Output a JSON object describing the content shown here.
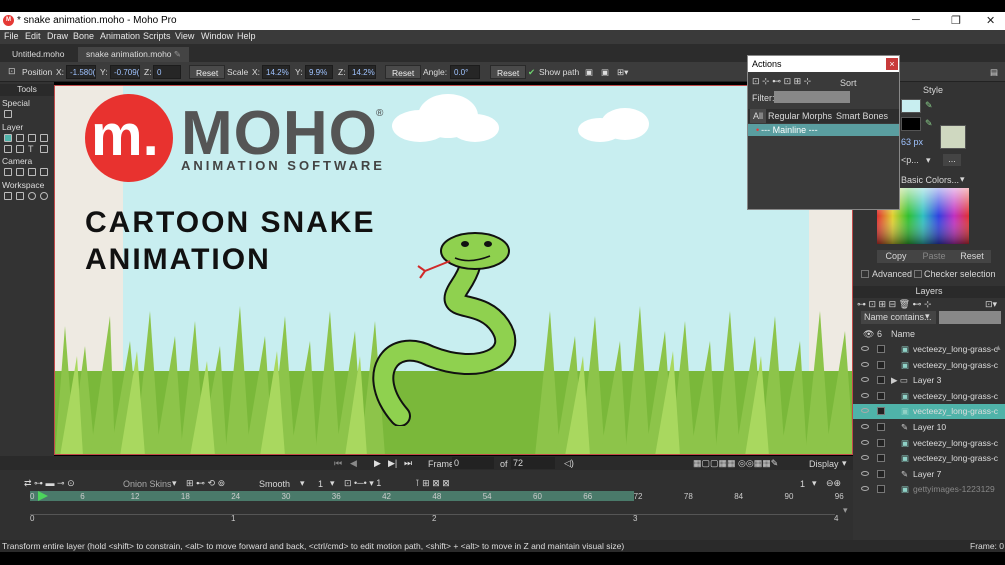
{
  "window": {
    "title": "* snake animation.moho - Moho Pro",
    "app_icon": "moho-app-icon"
  },
  "menu": [
    "File",
    "Edit",
    "Draw",
    "Bone",
    "Animation",
    "Scripts",
    "View",
    "Window",
    "Help"
  ],
  "tabs": [
    {
      "label": "Untitled.moho"
    },
    {
      "label": "snake animation.moho"
    }
  ],
  "tool_options": {
    "position_label": "Position",
    "x_label": "X:",
    "x_val": "-1.580(",
    "y_label": "Y:",
    "y_val": "-0.709(",
    "z_label": "Z:",
    "z_val": "0",
    "reset1": "Reset",
    "scale_label": "Scale",
    "sx_label": "X:",
    "sx_val": "14.2%",
    "sy_label": "Y:",
    "sy_val": "9.9%",
    "sz_label": "Z:",
    "sz_val": "14.2%",
    "reset2": "Reset",
    "angle_label": "Angle:",
    "angle_val": "0.0°",
    "reset3": "Reset",
    "show_path": "Show path"
  },
  "tools_panel": {
    "title": "Tools",
    "sections": [
      "Special",
      "Layer",
      "Camera",
      "Workspace"
    ]
  },
  "canvas": {
    "logo_letter": "m.",
    "logo_text": "MOHO",
    "logo_tm": "®",
    "logo_sub": "ANIMATION SOFTWARE",
    "headline1": "CARTOON SNAKE",
    "headline2": "ANIMATION"
  },
  "playbar": {
    "frame_label": "Frame",
    "frame_val": "0",
    "of_label": "of",
    "of_val": "72",
    "display_label": "Display"
  },
  "timeline": {
    "onion_label": "Onion Skins",
    "smooth_label": "Smooth",
    "smooth_val": "1",
    "kf_val": "1",
    "right_val": "1",
    "ticks": [
      "0",
      "6",
      "12",
      "18",
      "24",
      "30",
      "36",
      "42",
      "48",
      "54",
      "60",
      "66",
      "72",
      "78",
      "84",
      "90",
      "96"
    ],
    "sub_ticks": [
      "0",
      "1",
      "2",
      "3",
      "4"
    ]
  },
  "status": {
    "text": "Transform entire layer (hold <shift> to constrain, <alt> to move forward and back, <ctrl/cmd> to edit motion path, <shift> + <alt> to move in Z and maintain visual size)",
    "frame": "Frame: 0"
  },
  "style_panel": {
    "title": "Style",
    "px_val": "63 px",
    "p_val": "<p...",
    "palette_label": "Basic Colors...",
    "copy": "Copy",
    "paste": "Paste",
    "reset": "Reset",
    "advanced": "Advanced",
    "checker": "Checker selection",
    "fill_color": "#c8eef0",
    "stroke_color": "#000000"
  },
  "actions_panel": {
    "title": "Actions",
    "sort": "Sort",
    "filter_label": "Filter:",
    "tabs": [
      "All",
      "Regular",
      "Morphs",
      "Smart Bones"
    ],
    "mainline": "--- Mainline ---"
  },
  "layers_panel": {
    "title": "Layers",
    "filter_label": "Name contains...",
    "name_header": "Name",
    "layers": [
      {
        "name": "vecteezy_long-grass-c",
        "type": "image"
      },
      {
        "name": "vecteezy_long-grass-c",
        "type": "image"
      },
      {
        "name": "Layer 3",
        "type": "group"
      },
      {
        "name": "vecteezy_long-grass-c",
        "type": "image"
      },
      {
        "name": "vecteezy_long-grass-c",
        "type": "image",
        "selected": true
      },
      {
        "name": "Layer 10",
        "type": "vector"
      },
      {
        "name": "vecteezy_long-grass-c",
        "type": "image"
      },
      {
        "name": "vecteezy_long-grass-c",
        "type": "image"
      },
      {
        "name": "Layer 7",
        "type": "vector"
      },
      {
        "name": "gettyimages-1223129",
        "type": "image"
      }
    ]
  },
  "colors": {
    "accent": "#4fb3a9",
    "mainline": "#5a9ea0",
    "logo_red": "#e8322f",
    "snake": "#8fd14f"
  }
}
